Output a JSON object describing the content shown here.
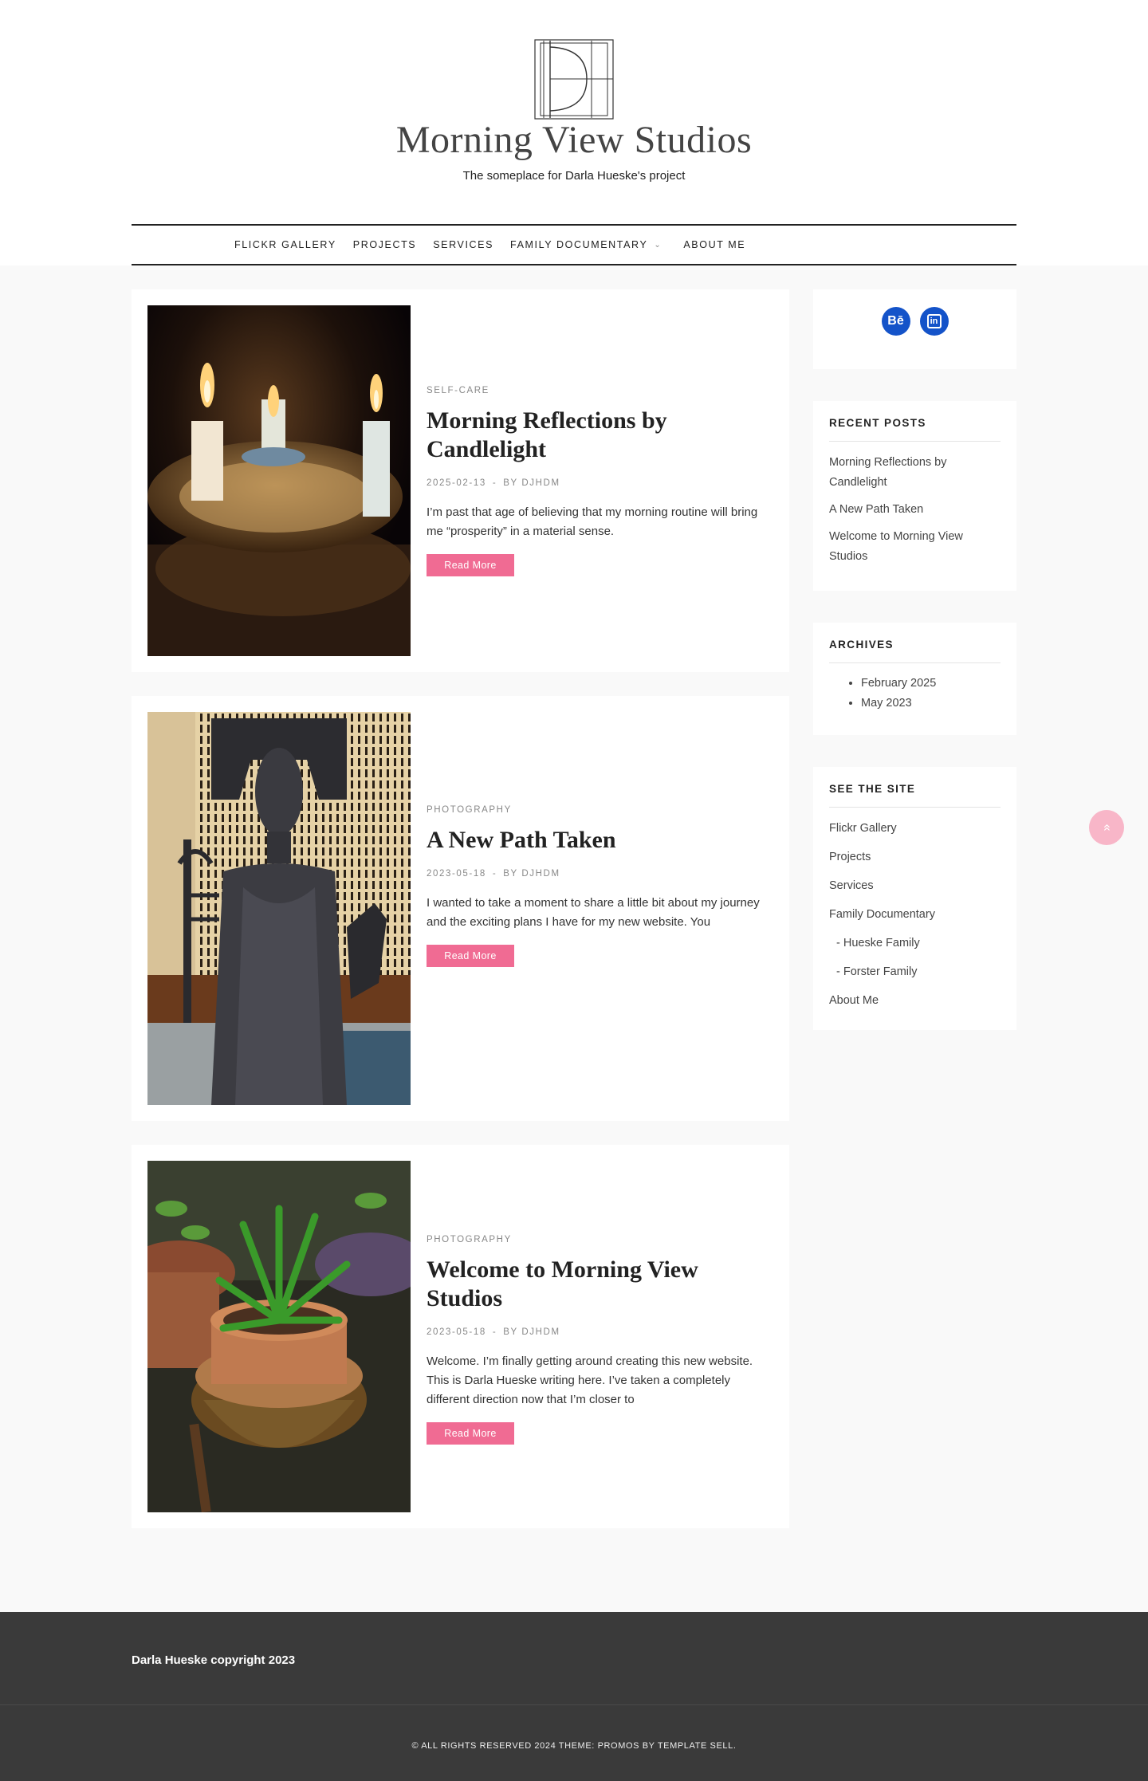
{
  "site": {
    "title": "Morning View Studios",
    "tagline": "The someplace for Darla Hueske's project"
  },
  "nav": {
    "items": [
      "FLICKR GALLERY",
      "PROJECTS",
      "SERVICES",
      "FAMILY DOCUMENTARY",
      "ABOUT ME"
    ]
  },
  "posts": [
    {
      "category": "SELF-CARE",
      "title": "Morning Reflections by Candlelight",
      "date": "2025-02-13",
      "author": "BY DJHDM",
      "excerpt": "I’m past that age of believing that my morning routine will bring me “prosperity” in a material sense.",
      "read_more": "Read More"
    },
    {
      "category": "PHOTOGRAPHY",
      "title": "A New Path Taken",
      "date": "2023-05-18",
      "author": "BY DJHDM",
      "excerpt": "I wanted to take a moment to share a little bit about my journey and the exciting plans I have for my new website. You",
      "read_more": "Read More"
    },
    {
      "category": "PHOTOGRAPHY",
      "title": "Welcome to Morning View Studios",
      "date": "2023-05-18",
      "author": "BY DJHDM",
      "excerpt": "Welcome. I’m finally getting around creating this new website. This is Darla Hueske writing here. I’ve taken a completely different direction now that I’m closer to",
      "read_more": "Read More"
    }
  ],
  "meta_separator": "-",
  "sidebar": {
    "social": [
      {
        "label": "Bē",
        "icon": "behance-icon"
      },
      {
        "label": "in",
        "icon": "linkedin-icon"
      }
    ],
    "recent_posts": {
      "heading": "RECENT POSTS",
      "items": [
        "Morning Reflections by Candlelight",
        "A New Path Taken",
        "Welcome to Morning View Studios"
      ]
    },
    "archives": {
      "heading": "ARCHIVES",
      "items": [
        "February 2025",
        "May 2023"
      ]
    },
    "see_the_site": {
      "heading": "SEE THE SITE",
      "items": [
        "Flickr Gallery",
        "Projects",
        "Services",
        "Family Documentary",
        "- Hueske Family",
        "- Forster Family",
        "About Me"
      ]
    }
  },
  "footer": {
    "copyright": "Darla Hueske copyright 2023",
    "credit": "© ALL RIGHTS RESERVED 2024 THEME: PROMOS BY TEMPLATE SELL."
  },
  "colors": {
    "accent": "#f06b93",
    "social_blue": "#1453c9",
    "footer_bg": "#3a3a3a"
  }
}
